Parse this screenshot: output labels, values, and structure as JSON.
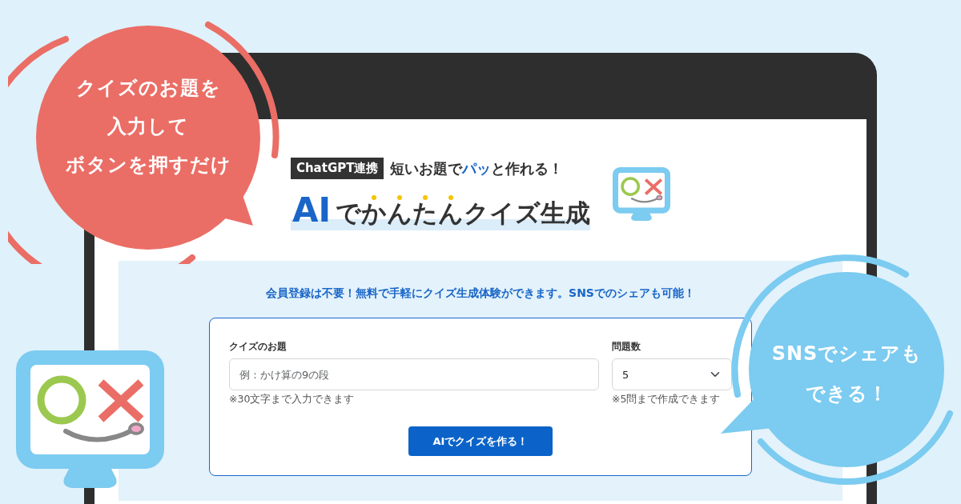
{
  "header": {
    "badge": "ChatGPT連携",
    "tagline": [
      {
        "text": "短いお題で",
        "kind": "plain"
      },
      {
        "text": "パッ",
        "kind": "accent"
      },
      {
        "text": "と作れる！",
        "kind": "plain"
      }
    ],
    "title": [
      {
        "text": "AI",
        "kind": "accent"
      },
      {
        "text": "で",
        "kind": "plain"
      },
      {
        "text": "かんたん",
        "kind": "emphasis"
      },
      {
        "text": "クイズ生成",
        "kind": "plain"
      }
    ]
  },
  "notice": "会員登録は不要！無料で手軽にクイズ生成体験ができます。SNSでのシェアも可能！",
  "form": {
    "topic": {
      "label": "クイズのお題",
      "placeholder": "例：かけ算の9の段",
      "hint": "※30文字まで入力できます"
    },
    "count": {
      "label": "問題数",
      "value": "5",
      "hint": "※5問まで作成できます"
    },
    "button": "AIでクイズを作る！"
  },
  "bubbles": [
    {
      "kind": "red",
      "lines": [
        "クイズのお題を",
        "入力して",
        "ボタンを押すだけ"
      ]
    },
    {
      "kind": "blue",
      "lines": [
        "SNSでシェアも",
        "できる！"
      ]
    }
  ]
}
